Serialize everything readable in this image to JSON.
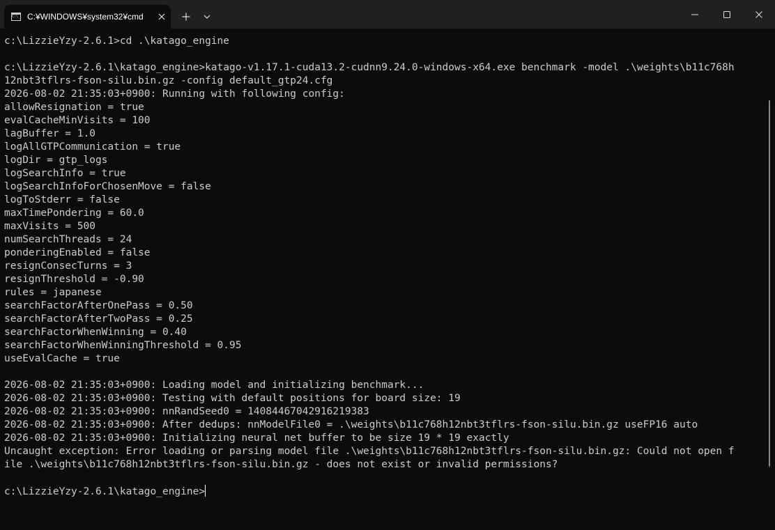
{
  "window": {
    "tab_title": "C:¥WINDOWS¥system32¥cmd",
    "tab_icon": "cmd-console-icon",
    "accent": "#202020",
    "terminal_bg": "#0c0c0c",
    "terminal_fg": "#cccccc"
  },
  "terminal": {
    "lines": [
      "c:\\LizzieYzy-2.6.1>cd .\\katago_engine",
      "",
      "c:\\LizzieYzy-2.6.1\\katago_engine>katago-v1.17.1-cuda13.2-cudnn9.24.0-windows-x64.exe benchmark -model .\\weights\\b11c768h",
      "12nbt3tflrs-fson-silu.bin.gz -config default_gtp24.cfg",
      "2026-08-02 21:35:03+0900: Running with following config:",
      "allowResignation = true",
      "evalCacheMinVisits = 100",
      "lagBuffer = 1.0",
      "logAllGTPCommunication = true",
      "logDir = gtp_logs",
      "logSearchInfo = true",
      "logSearchInfoForChosenMove = false",
      "logToStderr = false",
      "maxTimePondering = 60.0",
      "maxVisits = 500",
      "numSearchThreads = 24",
      "ponderingEnabled = false",
      "resignConsecTurns = 3",
      "resignThreshold = -0.90",
      "rules = japanese",
      "searchFactorAfterOnePass = 0.50",
      "searchFactorAfterTwoPass = 0.25",
      "searchFactorWhenWinning = 0.40",
      "searchFactorWhenWinningThreshold = 0.95",
      "useEvalCache = true",
      "",
      "2026-08-02 21:35:03+0900: Loading model and initializing benchmark...",
      "2026-08-02 21:35:03+0900: Testing with default positions for board size: 19",
      "2026-08-02 21:35:03+0900: nnRandSeed0 = 14084467042916219383",
      "2026-08-02 21:35:03+0900: After dedups: nnModelFile0 = .\\weights\\b11c768h12nbt3tflrs-fson-silu.bin.gz useFP16 auto",
      "2026-08-02 21:35:03+0900: Initializing neural net buffer to be size 19 * 19 exactly",
      "Uncaught exception: Error loading or parsing model file .\\weights\\b11c768h12nbt3tflrs-fson-silu.bin.gz: Could not open f",
      "ile .\\weights\\b11c768h12nbt3tflrs-fson-silu.bin.gz - does not exist or invalid permissions?",
      ""
    ],
    "prompt": "c:\\LizzieYzy-2.6.1\\katago_engine>"
  }
}
